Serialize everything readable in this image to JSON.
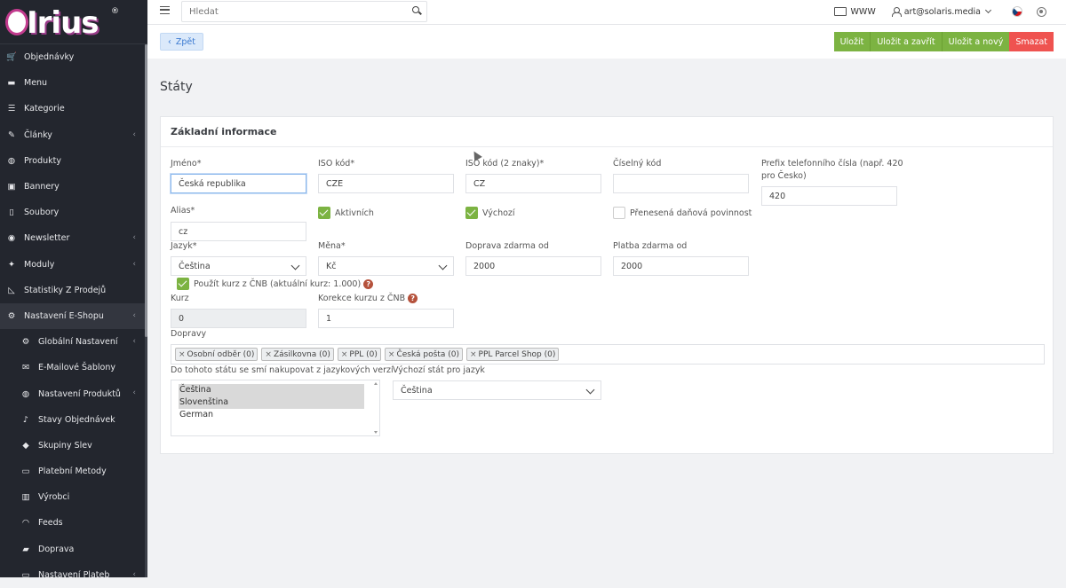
{
  "sidebar": {
    "logo_text": "Irius",
    "logo_mark": "®",
    "items": [
      {
        "label": "Objednávky",
        "icon": "cart-icon",
        "chevron": false
      },
      {
        "label": "Menu",
        "icon": "folder-icon",
        "chevron": false
      },
      {
        "label": "Kategorie",
        "icon": "list-icon",
        "chevron": false
      },
      {
        "label": "Články",
        "icon": "pencil-icon",
        "chevron": true
      },
      {
        "label": "Produkty",
        "icon": "basketball-icon",
        "chevron": false
      },
      {
        "label": "Bannery",
        "icon": "image-icon",
        "chevron": false
      },
      {
        "label": "Soubory",
        "icon": "file-icon",
        "chevron": false
      },
      {
        "label": "Newsletter",
        "icon": "mail-circle-icon",
        "chevron": true
      },
      {
        "label": "Moduly",
        "icon": "puzzle-icon",
        "chevron": true
      },
      {
        "label": "Statistiky Z Prodejů",
        "icon": "chart-icon",
        "chevron": false
      },
      {
        "label": "Nastavení E-Shopu",
        "icon": "wrench-icon",
        "chevron": true,
        "active": true
      }
    ],
    "sub_items": [
      {
        "label": "Globální Nastavení",
        "icon": "gear-icon",
        "chevron": true
      },
      {
        "label": "E-Mailové Šablony",
        "icon": "envelope-icon",
        "chevron": false
      },
      {
        "label": "Nastavení Produktů",
        "icon": "basketball-icon",
        "chevron": true
      },
      {
        "label": "Stavy Objednávek",
        "icon": "bell-icon",
        "chevron": false
      },
      {
        "label": "Skupiny Slev",
        "icon": "tag-icon",
        "chevron": false
      },
      {
        "label": "Platební Metody",
        "icon": "card-icon",
        "chevron": false
      },
      {
        "label": "Výrobci",
        "icon": "building-icon",
        "chevron": false
      },
      {
        "label": "Feeds",
        "icon": "rss-icon",
        "chevron": false
      },
      {
        "label": "Doprava",
        "icon": "truck-icon",
        "chevron": false
      },
      {
        "label": "Nastavení Plateb",
        "icon": "card-icon",
        "chevron": true
      }
    ]
  },
  "topbar": {
    "search_placeholder": "Hledat",
    "www_label": "WWW",
    "user_email": "art@solaris.media"
  },
  "actionbar": {
    "back_label": "Zpět",
    "save_label": "Uložit",
    "save_close_label": "Uložit a zavřít",
    "save_new_label": "Uložit a nový",
    "delete_label": "Smazat"
  },
  "page": {
    "title": "Státy",
    "panel_title": "Základní informace"
  },
  "form": {
    "name_label": "Jméno*",
    "name_value": "Česká republika",
    "iso_label": "ISO kód*",
    "iso_value": "CZE",
    "iso2_label": "ISO kód (2 znaky)*",
    "iso2_value": "CZ",
    "numeric_label": "Číselný kód",
    "numeric_value": "",
    "prefix_label_1": "Prefix telefonního čísla (např. 420",
    "prefix_label_2": "pro Česko)",
    "prefix_value": "420",
    "alias_label": "Alias*",
    "alias_value": "cz",
    "active_label": "Aktivních",
    "default_label": "Výchozí",
    "vat_label": "Přenesená daňová povinnost",
    "language_label": "Jazyk*",
    "language_value": "Čeština",
    "currency_label": "Měna*",
    "currency_value": "Kč",
    "free_shipping_label": "Doprava zdarma od",
    "free_shipping_value": "2000",
    "free_payment_label": "Platba zdarma od",
    "free_payment_value": "2000",
    "cnb_label": "Použít kurz z ČNB (aktuální kurz: 1.000)",
    "rate_label": "Kurz",
    "rate_value": "0",
    "rate_corr_label": "Korekce kurzu z ČNB",
    "rate_corr_value": "1",
    "shipping_label": "Dopravy",
    "shipping_tags": [
      "Osobní odběr (0)",
      "Zásilkovna (0)",
      "PPL (0)",
      "Česká pošta (0)",
      "PPL Parcel Shop (0)"
    ],
    "languages_list_label": "Do tohoto státu se smí nakupovat z jazykových verzí",
    "languages_list": [
      "Čeština",
      "Slovenština",
      "German"
    ],
    "default_country_label": "Výchozí stát pro jazyk",
    "default_country_value": "Čeština",
    "help_glyph": "?"
  }
}
